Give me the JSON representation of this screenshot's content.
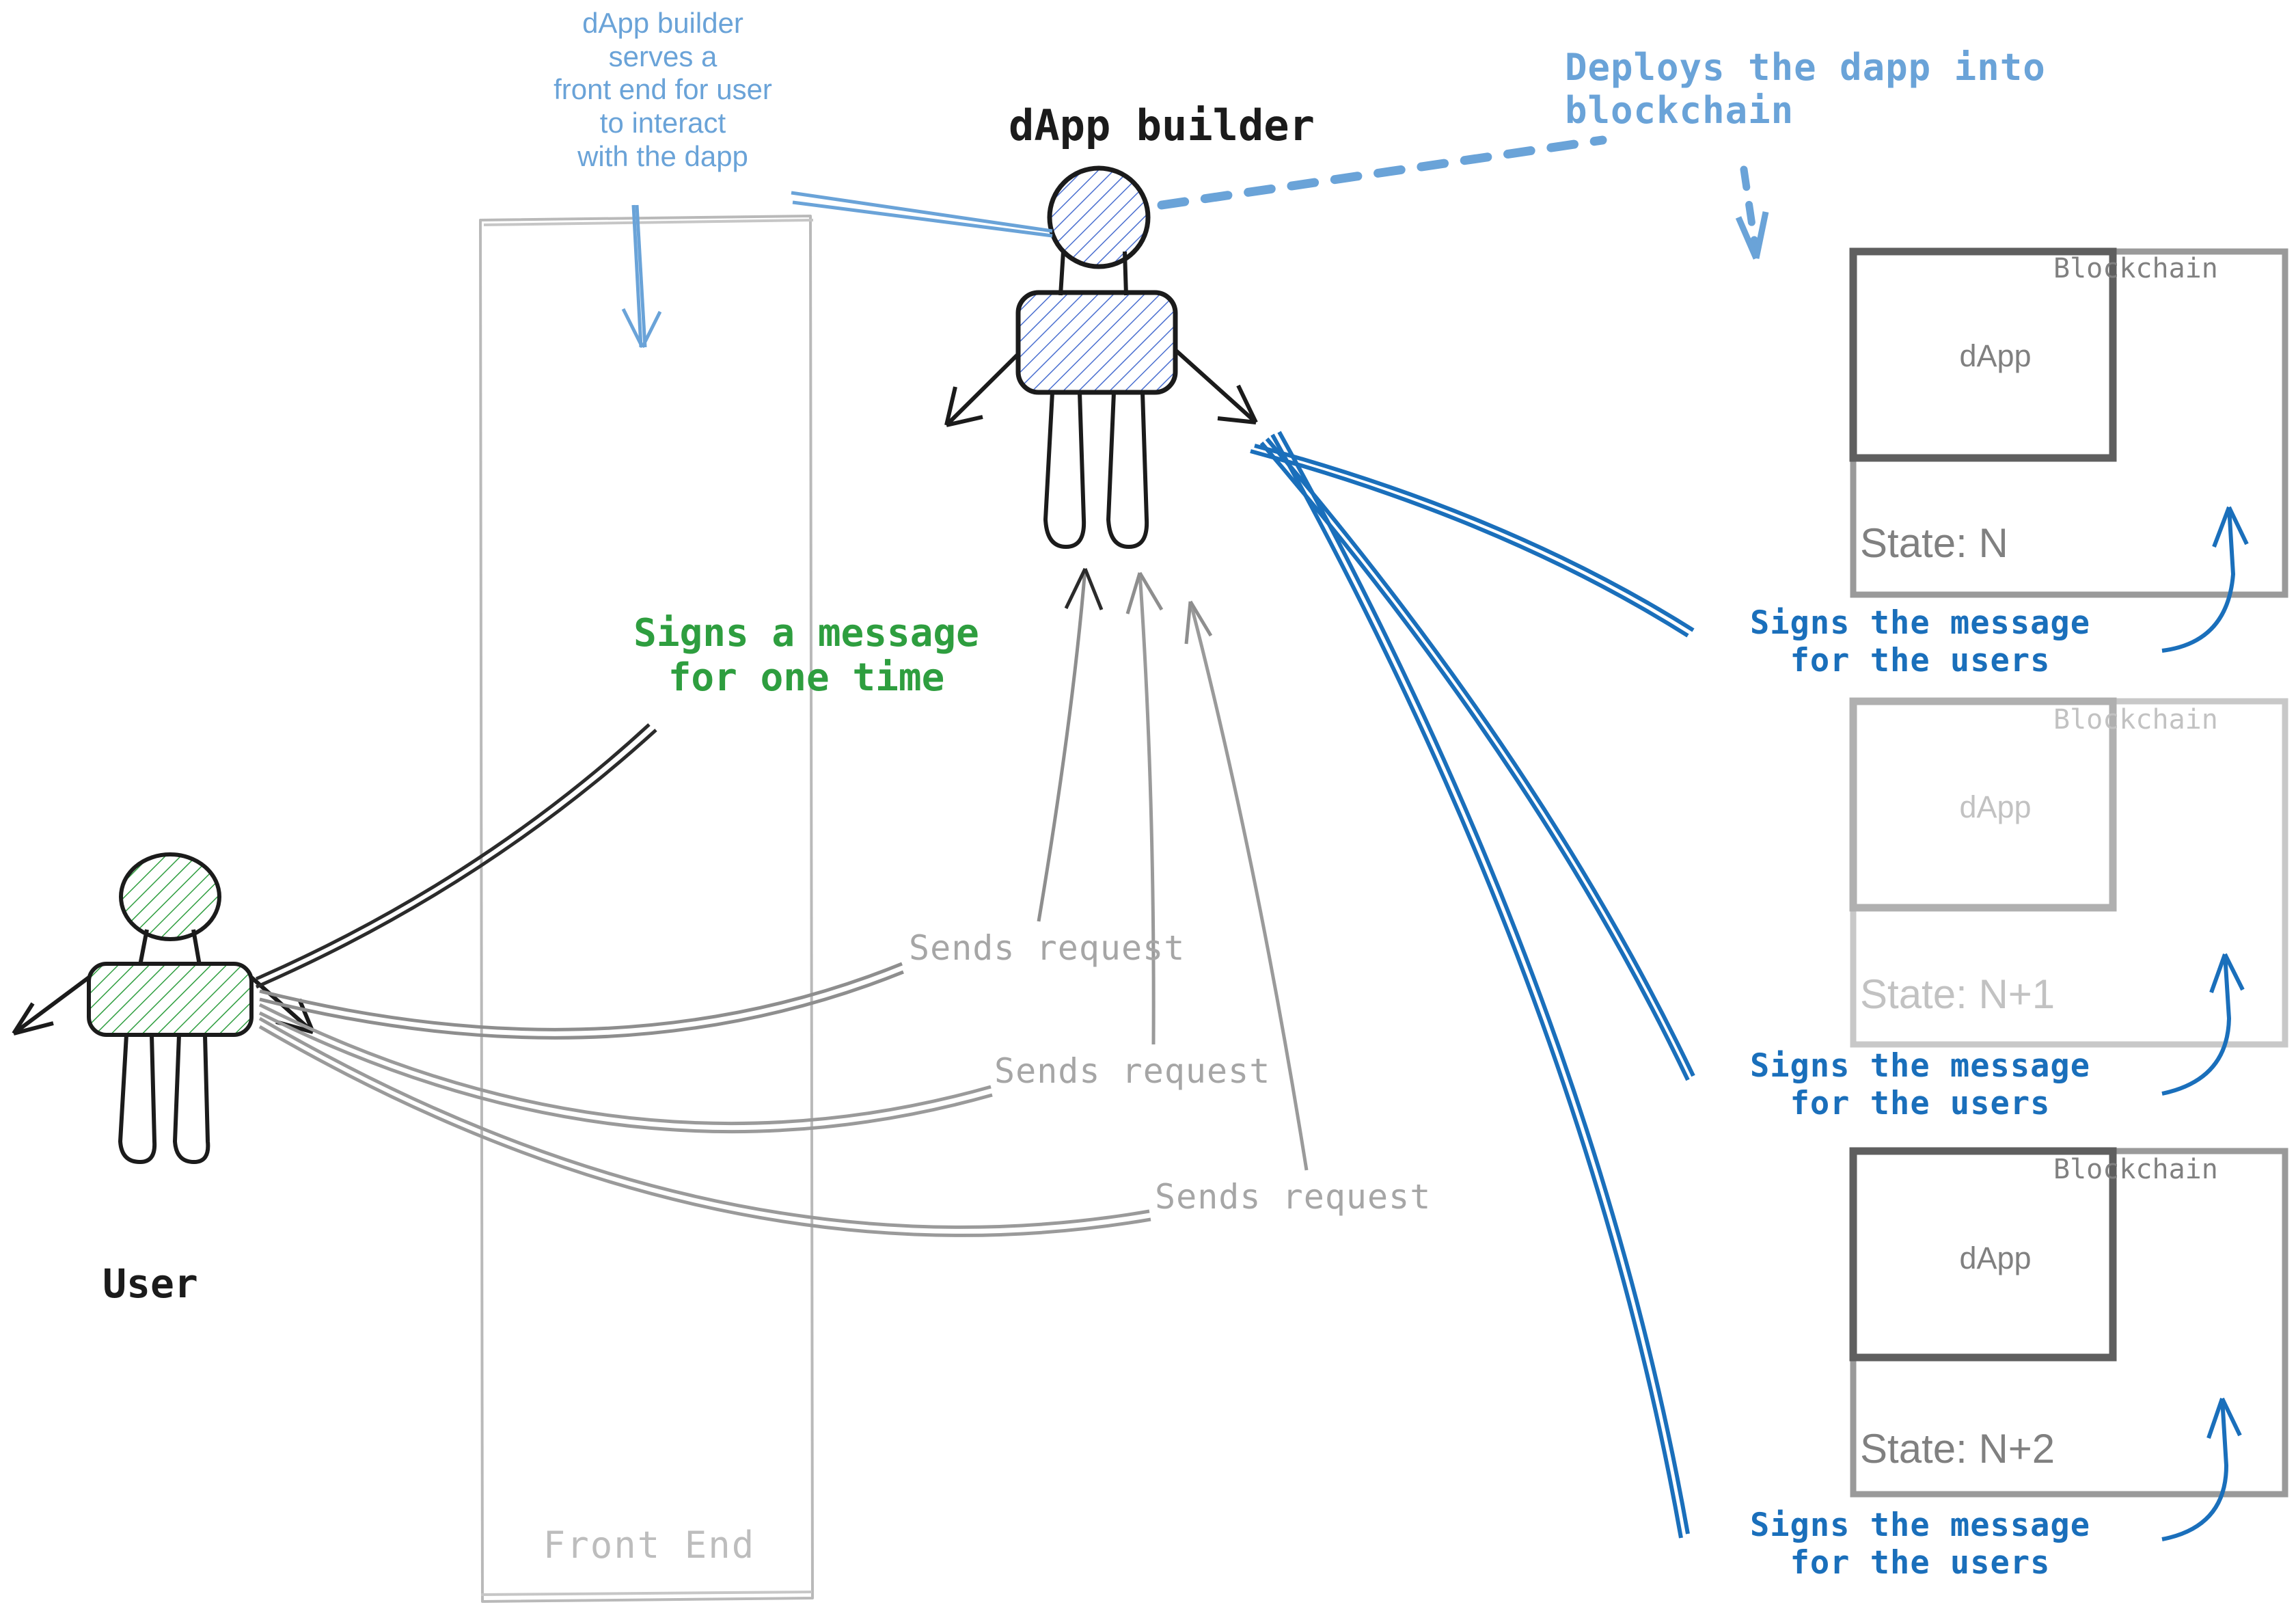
{
  "diagram": {
    "title": "dApp builder / user / blockchain interaction sketch",
    "colors": {
      "light_blue": "#6aa3d8",
      "strong_blue": "#1a6fbb",
      "green": "#2e9e3f",
      "gray": "#a6a6a6",
      "light_gray": "#c2c2c2",
      "dark": "#1b1b1b"
    }
  },
  "actors": {
    "user": {
      "label": "User",
      "fill_color": "#2e9e3f"
    },
    "builder": {
      "label": "dApp builder",
      "fill_color": "#4a6fd0"
    }
  },
  "annotations": {
    "builder_serves_frontend": "dApp builder\nserves a\nfront end for user\nto interact\nwith the dapp",
    "deploys_into_blockchain": "Deploys the dapp into\nblockchain",
    "signs_once": "Signs a message\nfor one time",
    "sends_request_1": "Sends request",
    "sends_request_2": "Sends request",
    "sends_request_3": "Sends request",
    "signs_for_users_1": "Signs the message\nfor the users",
    "signs_for_users_2": "Signs the message\nfor the users",
    "signs_for_users_3": "Signs the message\nfor the users"
  },
  "frontend": {
    "label": "Front End"
  },
  "blockchains": [
    {
      "chain_label": "Blockchain",
      "dapp_label": "dApp",
      "state_label": "State: N",
      "style": "strong"
    },
    {
      "chain_label": "Blockchain",
      "dapp_label": "dApp",
      "state_label": "State: N+1",
      "style": "faded"
    },
    {
      "chain_label": "Blockchain",
      "dapp_label": "dApp",
      "state_label": "State: N+2",
      "style": "strong"
    }
  ]
}
